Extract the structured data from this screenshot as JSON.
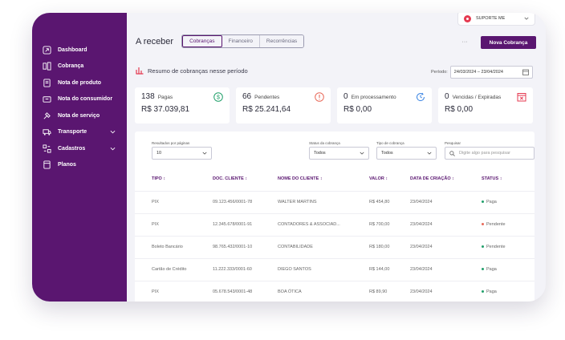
{
  "colors": {
    "brand": "#5a1670",
    "paid": "#22a06b",
    "pending": "#e86a5a",
    "processing": "#3d86e3",
    "expired": "#e53950"
  },
  "header": {
    "support_label": "SUPORTE ME"
  },
  "sidebar": {
    "items": [
      {
        "label": "Dashboard",
        "icon": "dashboard-icon"
      },
      {
        "label": "Cobrança",
        "icon": "billing-icon"
      },
      {
        "label": "Nota de produto",
        "icon": "product-invoice-icon"
      },
      {
        "label": "Nota do consumidor",
        "icon": "consumer-invoice-icon"
      },
      {
        "label": "Nota de serviço",
        "icon": "service-invoice-icon"
      },
      {
        "label": "Transporte",
        "icon": "transport-icon",
        "expandable": true
      },
      {
        "label": "Cadastros",
        "icon": "registry-icon",
        "expandable": true
      },
      {
        "label": "Planos",
        "icon": "plans-icon"
      }
    ]
  },
  "page": {
    "title": "A receber",
    "tabs": [
      "Cobranças",
      "Financeiro",
      "Recorrências"
    ],
    "more_label": "···",
    "new_button": "Nova Cobrança"
  },
  "summary": {
    "title": "Resumo de cobranças nesse período",
    "period_label": "Período:",
    "period_value": "24/03/2024 – 23/04/2024"
  },
  "cards": [
    {
      "count": "138",
      "label": "Pagas",
      "amount": "R$ 37.039,81",
      "icon": "dollar-circle-icon"
    },
    {
      "count": "66",
      "label": "Pendentes",
      "amount": "R$ 25.241,64",
      "icon": "alert-circle-icon"
    },
    {
      "count": "0",
      "label": "Em processamento",
      "amount": "R$ 0,00",
      "icon": "clock-refresh-icon"
    },
    {
      "count": "0",
      "label": "Vencidas / Expiradas",
      "amount": "R$ 0,00",
      "icon": "calendar-x-icon"
    }
  ],
  "filters": {
    "per_page_label": "Resultados por páginas",
    "per_page_value": "10",
    "status_label": "Status da cobrança",
    "status_value": "Todos",
    "type_label": "Tipo de cobrança",
    "type_value": "Todos",
    "search_label": "Pesquisar",
    "search_placeholder": "Digite algo para pesquisar"
  },
  "table": {
    "columns": [
      "TIPO",
      "DOC. CLIENTE",
      "NOME DO CLIENTE",
      "VALOR",
      "DATA DE CRIAÇÃO",
      "STATUS"
    ],
    "rows": [
      {
        "tipo": "PIX",
        "doc": "09.123.456/0001-78",
        "nome": "WALTER MARTINS",
        "valor": "R$ 454,80",
        "data": "23/04/2024",
        "status": "Paga",
        "status_key": "paid"
      },
      {
        "tipo": "PIX",
        "doc": "12.345.678/0001-91",
        "nome": "CONTADORES & ASSOCIAD...",
        "valor": "R$ 700,00",
        "data": "23/04/2024",
        "status": "Pendente",
        "status_key": "pending_red"
      },
      {
        "tipo": "Boleto Bancário",
        "doc": "98.765.432/0001-10",
        "nome": "CONTABILIDADE",
        "valor": "R$ 180,00",
        "data": "23/04/2024",
        "status": "Pendente",
        "status_key": "pending"
      },
      {
        "tipo": "Cartão de Crédito",
        "doc": "11.222.333/0001-60",
        "nome": "DIEGO SANTOS",
        "valor": "R$ 144,00",
        "data": "23/04/2024",
        "status": "Paga",
        "status_key": "paid"
      },
      {
        "tipo": "PIX",
        "doc": "05.678.543/0001-48",
        "nome": "BOA ÓTICA",
        "valor": "R$ 89,90",
        "data": "23/04/2024",
        "status": "Paga",
        "status_key": "paid"
      }
    ]
  }
}
